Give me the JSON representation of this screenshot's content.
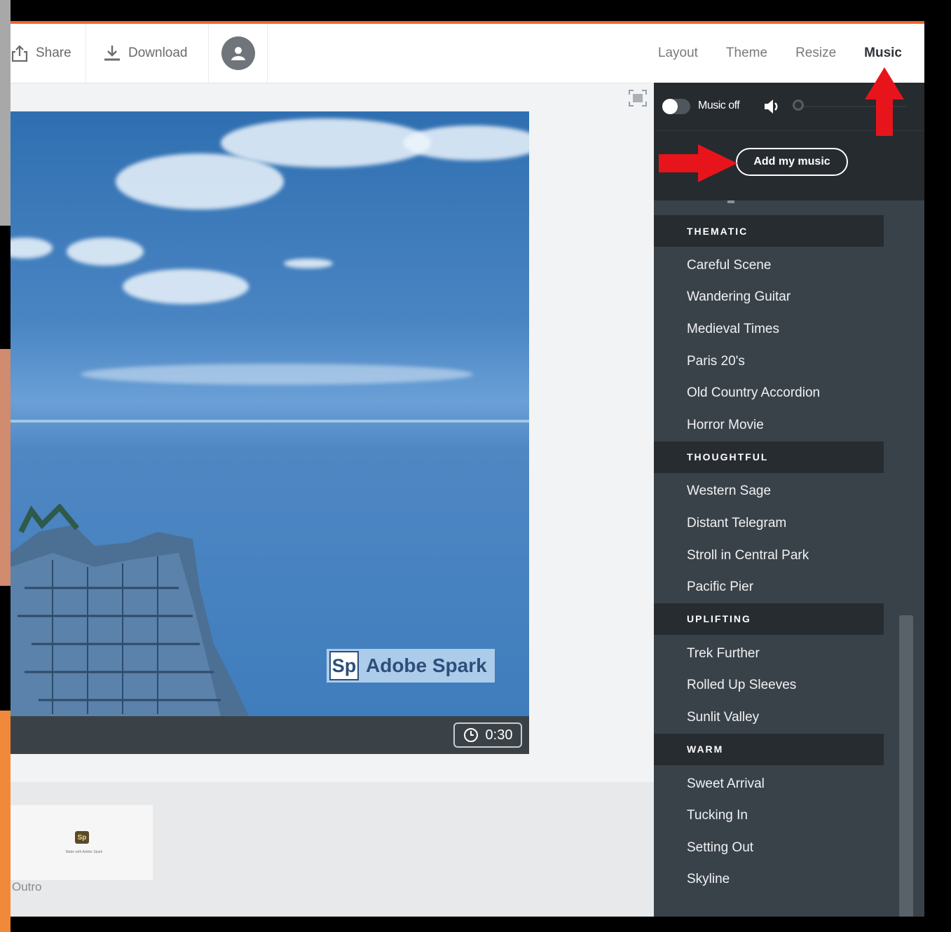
{
  "toolbar": {
    "share_label": "Share",
    "download_label": "Download",
    "avatar_icon": "user-icon"
  },
  "tabs": [
    {
      "label": "Layout",
      "active": false
    },
    {
      "label": "Theme",
      "active": false
    },
    {
      "label": "Resize",
      "active": false
    },
    {
      "label": "Music",
      "active": true
    }
  ],
  "slide": {
    "watermark_badge": "Sp",
    "watermark_text": "Adobe Spark",
    "duration": "0:30"
  },
  "bottom": {
    "thumb_badge": "Sp",
    "thumb_caption": "Made with Adobe Spark",
    "outro_label": "Outro"
  },
  "music_panel": {
    "toggle_label": "Music off",
    "add_button": "Add my music",
    "categories": [
      {
        "name": "THEMATIC",
        "tracks": [
          "Careful Scene",
          "Wandering Guitar",
          "Medieval Times",
          "Paris 20's",
          "Old Country Accordion",
          "Horror Movie"
        ]
      },
      {
        "name": "THOUGHTFUL",
        "tracks": [
          "Western Sage",
          "Distant Telegram",
          "Stroll in Central Park",
          "Pacific Pier"
        ]
      },
      {
        "name": "UPLIFTING",
        "tracks": [
          "Trek Further",
          "Rolled Up Sleeves",
          "Sunlit Valley"
        ]
      },
      {
        "name": "WARM",
        "tracks": [
          "Sweet Arrival",
          "Tucking In",
          "Setting Out",
          "Skyline"
        ]
      }
    ]
  },
  "colors": {
    "accent_line": "#f0652a",
    "annotation_red": "#e8141b",
    "panel_bg": "#3a4249",
    "category_bg": "#272c31"
  }
}
